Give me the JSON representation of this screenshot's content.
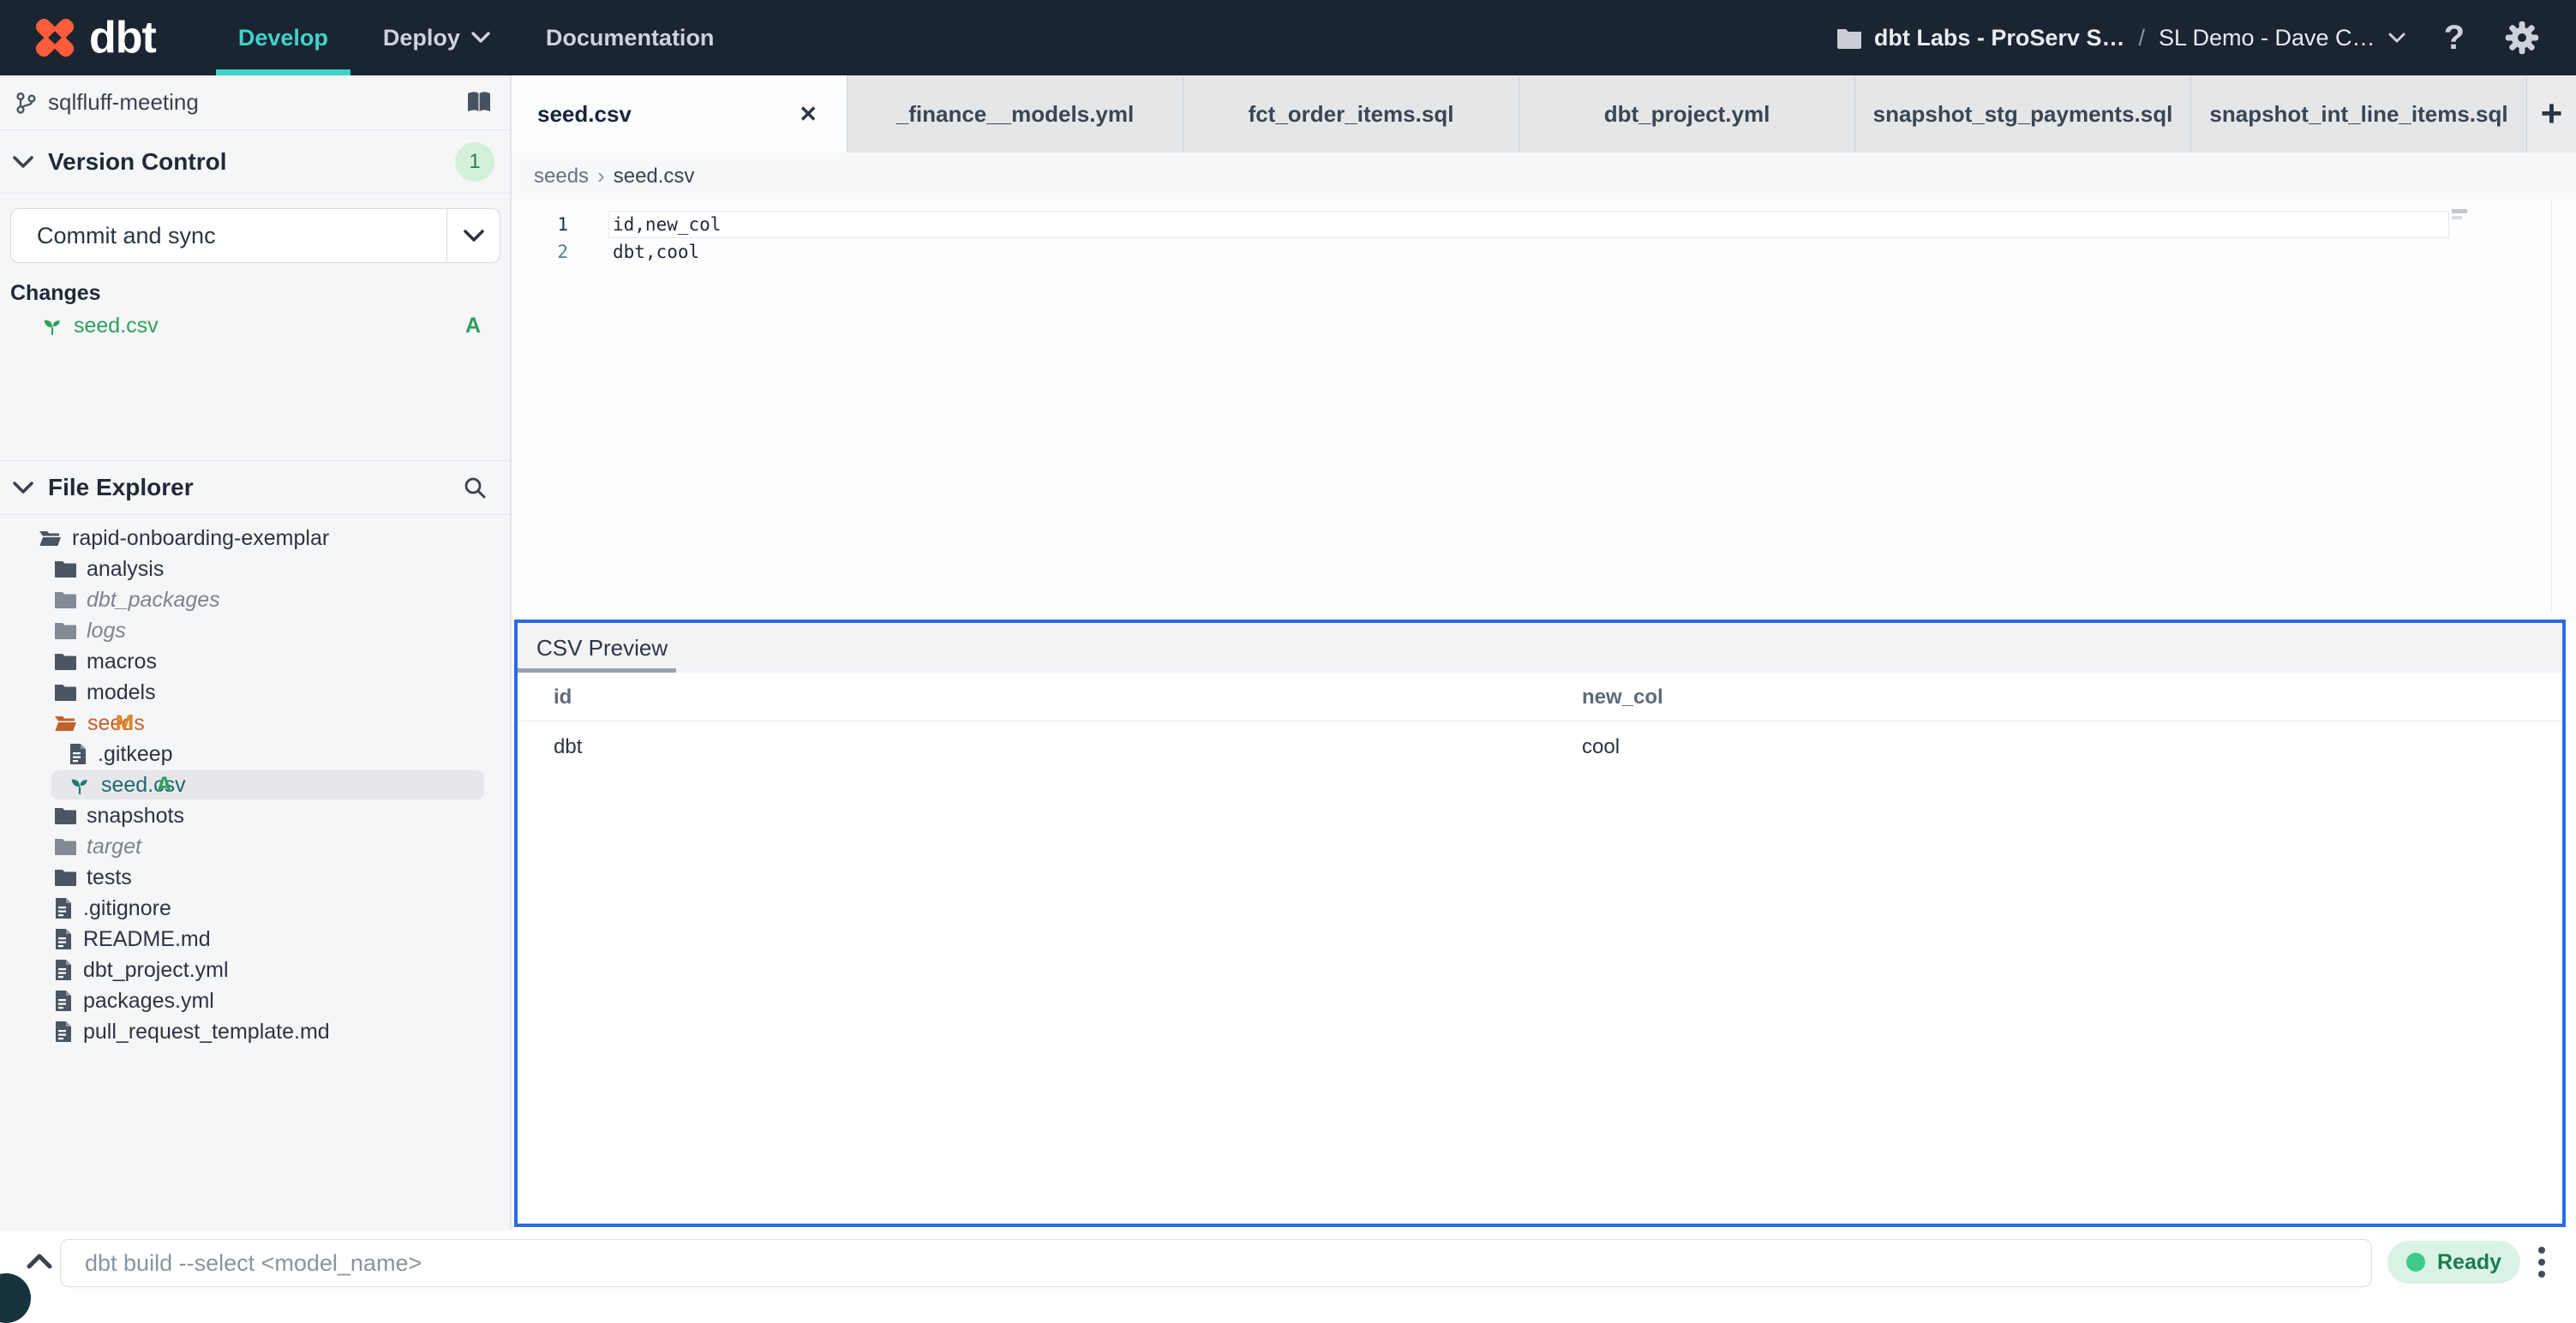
{
  "colors": {
    "nav_bg": "#1b2431",
    "accent_teal": "#3ed3ca",
    "brand_orange": "#ff5c3c",
    "panel_blue": "#2a6ce6",
    "status_green": "#3fc98c",
    "badge_green": "#2e9e5b",
    "badge_orange": "#df862c"
  },
  "icons": {
    "close": "✕",
    "plus": "+",
    "help": "?",
    "crumb_sep": "›"
  },
  "nav": {
    "brand": "dbt",
    "items": [
      {
        "label": "Develop"
      },
      {
        "label": "Deploy"
      },
      {
        "label": "Documentation"
      }
    ],
    "account_org": "dbt Labs - ProServ S…",
    "account_sep": "/",
    "account_project": "SL Demo - Dave C…"
  },
  "sidebar": {
    "branch_name": "sqlfluff-meeting",
    "version_control": {
      "title": "Version Control",
      "badge": "1",
      "commit_button": "Commit and sync",
      "changes_label": "Changes",
      "changes": [
        {
          "label": "seed.csv",
          "badge": "A"
        }
      ]
    },
    "file_explorer": {
      "title": "File Explorer",
      "tree": [
        {
          "label": "rapid-onboarding-exemplar"
        },
        {
          "label": "analysis"
        },
        {
          "label": "dbt_packages"
        },
        {
          "label": "logs"
        },
        {
          "label": "macros"
        },
        {
          "label": "models"
        },
        {
          "label": "seeds",
          "badge": "M"
        },
        {
          "label": ".gitkeep"
        },
        {
          "label": "seed.csv",
          "badge": "A"
        },
        {
          "label": "snapshots"
        },
        {
          "label": "target"
        },
        {
          "label": "tests"
        },
        {
          "label": ".gitignore"
        },
        {
          "label": "README.md"
        },
        {
          "label": "dbt_project.yml"
        },
        {
          "label": "packages.yml"
        },
        {
          "label": "pull_request_template.md"
        }
      ]
    }
  },
  "tabs": [
    {
      "label": "seed.csv"
    },
    {
      "label": "_finance__models.yml"
    },
    {
      "label": "fct_order_items.sql"
    },
    {
      "label": "dbt_project.yml"
    },
    {
      "label": "snapshot_stg_payments.sql"
    },
    {
      "label": "snapshot_int_line_items.sql"
    }
  ],
  "editor": {
    "breadcrumb": [
      "seeds",
      "seed.csv"
    ],
    "lines": [
      {
        "num": "1",
        "code": "id,new_col"
      },
      {
        "num": "2",
        "code": "dbt,cool"
      }
    ]
  },
  "csv_preview": {
    "title": "CSV Preview",
    "columns": [
      "id",
      "new_col"
    ],
    "rows": [
      [
        "dbt",
        "cool"
      ]
    ]
  },
  "status_bar": {
    "placeholder": "dbt build --select <model_name>",
    "status": "Ready"
  }
}
